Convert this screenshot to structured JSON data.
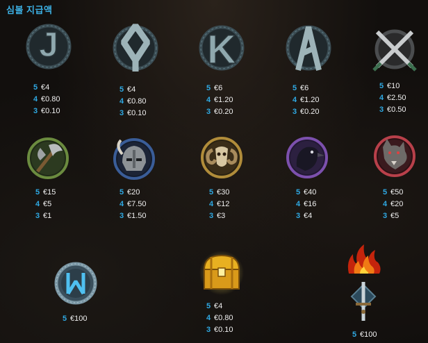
{
  "title": "심볼 지급액",
  "letters": [
    {
      "glyph": "J",
      "icon": "rune-j-icon",
      "pays": [
        {
          "count": "5",
          "amount": "€4"
        },
        {
          "count": "4",
          "amount": "€0.80"
        },
        {
          "count": "3",
          "amount": "€0.10"
        }
      ]
    },
    {
      "glyph": "Q",
      "icon": "rune-q-icon",
      "pays": [
        {
          "count": "5",
          "amount": "€4"
        },
        {
          "count": "4",
          "amount": "€0.80"
        },
        {
          "count": "3",
          "amount": "€0.10"
        }
      ]
    },
    {
      "glyph": "K",
      "icon": "rune-k-icon",
      "pays": [
        {
          "count": "5",
          "amount": "€6"
        },
        {
          "count": "4",
          "amount": "€1.20"
        },
        {
          "count": "3",
          "amount": "€0.20"
        }
      ]
    },
    {
      "glyph": "A",
      "icon": "rune-a-icon",
      "pays": [
        {
          "count": "5",
          "amount": "€6"
        },
        {
          "count": "4",
          "amount": "€1.20"
        },
        {
          "count": "3",
          "amount": "€0.20"
        }
      ]
    },
    {
      "glyph": "",
      "icon": "crossed-swords-icon",
      "pays": [
        {
          "count": "5",
          "amount": "€10"
        },
        {
          "count": "4",
          "amount": "€2.50"
        },
        {
          "count": "3",
          "amount": "€0.50"
        }
      ]
    }
  ],
  "premium": [
    {
      "icon": "battle-axe-icon",
      "ring": "#4d7a2c",
      "pays": [
        {
          "count": "5",
          "amount": "€15"
        },
        {
          "count": "4",
          "amount": "€5"
        },
        {
          "count": "3",
          "amount": "€1"
        }
      ]
    },
    {
      "icon": "viking-helmet-icon",
      "ring": "#2c4f86",
      "pays": [
        {
          "count": "5",
          "amount": "€20"
        },
        {
          "count": "4",
          "amount": "€7.50"
        },
        {
          "count": "3",
          "amount": "€1.50"
        }
      ]
    },
    {
      "icon": "ram-skull-icon",
      "ring": "#9a7a2c",
      "pays": [
        {
          "count": "5",
          "amount": "€30"
        },
        {
          "count": "4",
          "amount": "€12"
        },
        {
          "count": "3",
          "amount": "€3"
        }
      ]
    },
    {
      "icon": "raven-icon",
      "ring": "#6a3e95",
      "pays": [
        {
          "count": "5",
          "amount": "€40"
        },
        {
          "count": "4",
          "amount": "€16"
        },
        {
          "count": "3",
          "amount": "€4"
        }
      ]
    },
    {
      "icon": "wolf-icon",
      "ring": "#a8313a",
      "pays": [
        {
          "count": "5",
          "amount": "€50"
        },
        {
          "count": "4",
          "amount": "€20"
        },
        {
          "count": "3",
          "amount": "€5"
        }
      ]
    }
  ],
  "special": {
    "wild": {
      "icon": "wild-rune-icon",
      "pays": [
        {
          "count": "5",
          "amount": "€100"
        }
      ]
    },
    "chest": {
      "icon": "treasure-chest-icon",
      "pays": [
        {
          "count": "5",
          "amount": "€4"
        },
        {
          "count": "4",
          "amount": "€0.80"
        },
        {
          "count": "3",
          "amount": "€0.10"
        }
      ]
    },
    "fire": {
      "icon": "fire-icon"
    },
    "sword": {
      "icon": "sword-emblem-icon",
      "pays": [
        {
          "count": "5",
          "amount": "€100"
        }
      ]
    }
  }
}
